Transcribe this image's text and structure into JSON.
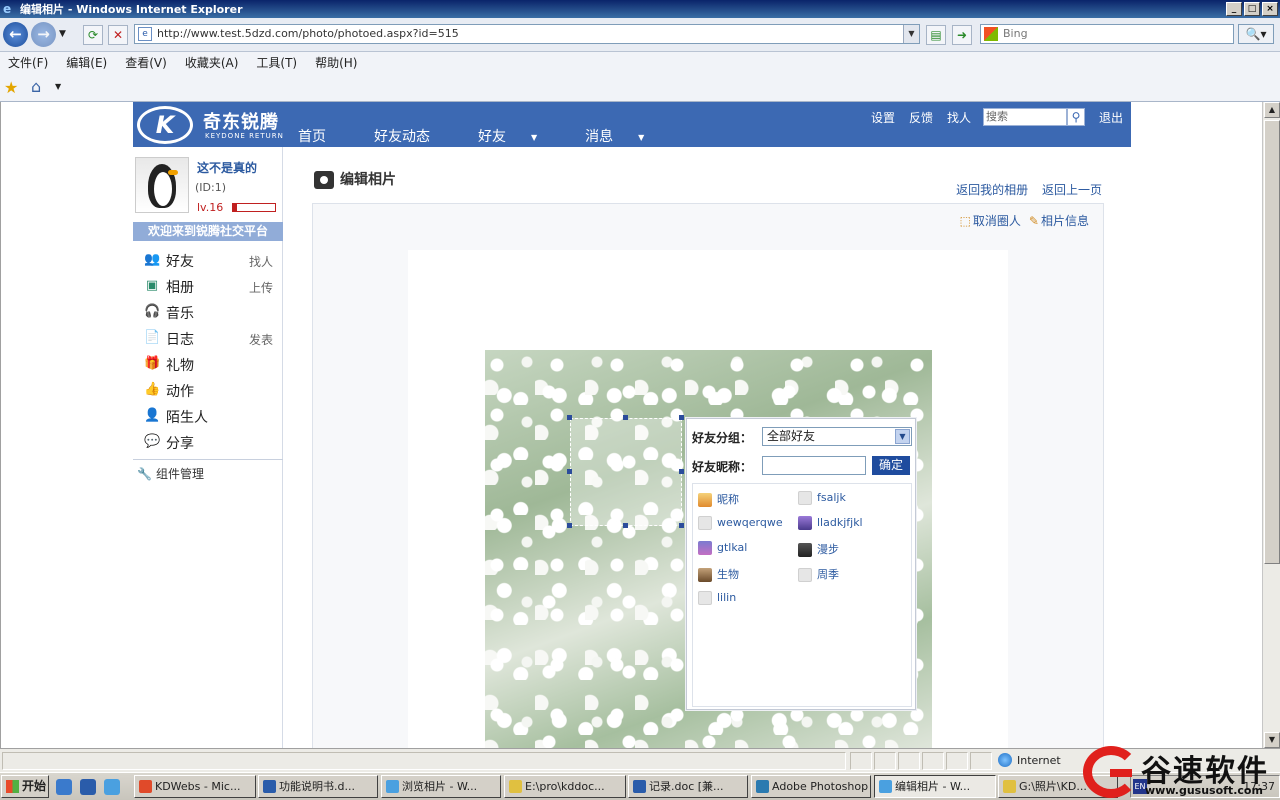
{
  "window": {
    "title": "编辑相片 - Windows Internet Explorer"
  },
  "browser": {
    "url": "http://www.test.5dzd.com/photo/photoed.aspx?id=515",
    "search_placeholder": "Bing",
    "menu": [
      "文件(F)",
      "编辑(E)",
      "查看(V)",
      "收藏夹(A)",
      "工具(T)",
      "帮助(H)"
    ],
    "status_zone": "Internet"
  },
  "site": {
    "logo_cn": "奇东锐腾",
    "logo_en": "KEYDONE RETURN",
    "logo_mark": "K",
    "nav": [
      "首页",
      "好友动态",
      "好友",
      "消息"
    ],
    "top_links": {
      "settings": "设置",
      "feedback": "反馈",
      "find": "找人",
      "search_placeholder": "搜索",
      "logout": "退出"
    }
  },
  "user": {
    "name": "这不是真的",
    "id": "(ID:1)",
    "level": "lv.16",
    "level_progress": 0.1
  },
  "sidebar": {
    "welcome": "欢迎来到锐腾社交平台",
    "items": [
      {
        "label": "好友",
        "sub": "找人",
        "icon": "friends-icon"
      },
      {
        "label": "相册",
        "sub": "上传",
        "icon": "album-icon"
      },
      {
        "label": "音乐",
        "sub": "",
        "icon": "headphones-icon"
      },
      {
        "label": "日志",
        "sub": "发表",
        "icon": "blog-icon"
      },
      {
        "label": "礼物",
        "sub": "",
        "icon": "gift-icon"
      },
      {
        "label": "动作",
        "sub": "",
        "icon": "hand-icon"
      },
      {
        "label": "陌生人",
        "sub": "",
        "icon": "stranger-icon"
      },
      {
        "label": "分享",
        "sub": "",
        "icon": "share-icon"
      }
    ],
    "widget_manage": "组件管理"
  },
  "content": {
    "title": "编辑相片",
    "back_album": "返回我的相册",
    "back_prev": "返回上一页",
    "cancel_tag": "取消圈人",
    "photo_info": "相片信息"
  },
  "tag_popup": {
    "group_label": "好友分组：",
    "group_value": "全部好友",
    "nick_label": "好友昵称：",
    "confirm": "确定",
    "friends": [
      {
        "name": "昵称",
        "avatar": "a1"
      },
      {
        "name": "fsaljk",
        "avatar": "gen"
      },
      {
        "name": "wewqerqwe",
        "avatar": "gen"
      },
      {
        "name": "lladkjfjkl",
        "avatar": "a2"
      },
      {
        "name": "gtlkal",
        "avatar": "a3"
      },
      {
        "name": "漫步",
        "avatar": "a4"
      },
      {
        "name": "生物",
        "avatar": "a5"
      },
      {
        "name": "周季",
        "avatar": "gen"
      },
      {
        "name": "lilin",
        "avatar": "gen"
      }
    ]
  },
  "taskbar": {
    "start": "开始",
    "tasks": [
      "KDWebs - Mic...",
      "功能说明书.d...",
      "浏览相片 - W...",
      "E:\\pro\\kddoc...",
      "记录.doc [兼...",
      "Adobe Photoshop",
      "编辑相片 - W...",
      "G:\\照片\\KD..."
    ],
    "active_task": 6,
    "lang": "EN",
    "clock": "17:37"
  },
  "watermark": {
    "brand": "谷速软件",
    "url": "www.gususoft.com"
  },
  "colors": {
    "header_blue": "#3c69b3",
    "link_blue": "#2c5aa0",
    "welcome_bar": "#91acd8",
    "confirm_btn": "#1f4c9e",
    "level_red": "#c02020",
    "watermark_red": "#e0201c"
  }
}
